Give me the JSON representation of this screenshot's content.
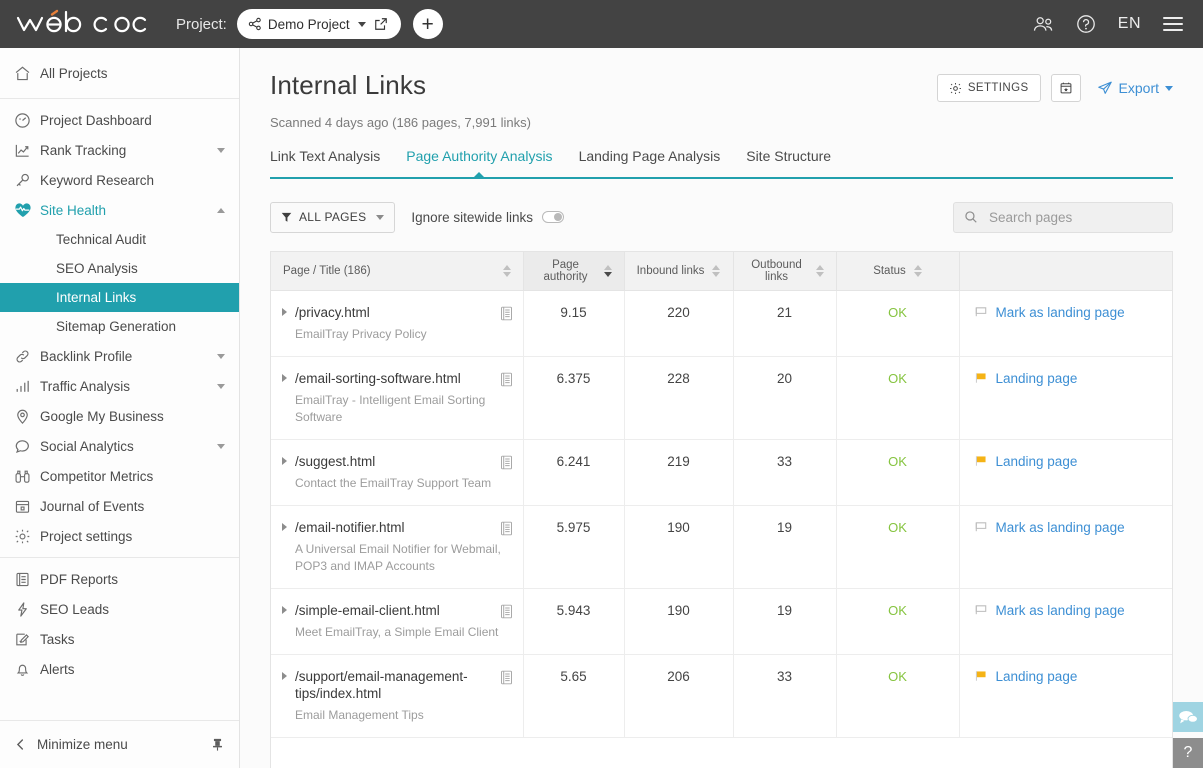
{
  "topbar": {
    "logo_text": "web ceo",
    "project_label": "Project:",
    "project_name": "Demo Project",
    "add_title": "+",
    "language": "EN"
  },
  "sidebar": {
    "home": {
      "label": "All Projects",
      "icon": "home-icon"
    },
    "items": [
      {
        "label": "Project Dashboard",
        "icon": "dashboard-icon",
        "expandable": false
      },
      {
        "label": "Rank Tracking",
        "icon": "chart-line-icon",
        "expandable": true
      },
      {
        "label": "Keyword Research",
        "icon": "key-icon",
        "expandable": false
      },
      {
        "label": "Site Health",
        "icon": "heartbeat-icon",
        "expandable": true,
        "active": true,
        "expanded": true
      },
      {
        "label": "Backlink Profile",
        "icon": "link-icon",
        "expandable": true
      },
      {
        "label": "Traffic Analysis",
        "icon": "bar-chart-icon",
        "expandable": true
      },
      {
        "label": "Google My Business",
        "icon": "map-pin-icon",
        "expandable": false
      },
      {
        "label": "Social Analytics",
        "icon": "speech-bubble-icon",
        "expandable": true
      },
      {
        "label": "Competitor Metrics",
        "icon": "binoculars-icon",
        "expandable": false
      },
      {
        "label": "Journal of Events",
        "icon": "calendar-icon",
        "expandable": false
      },
      {
        "label": "Project settings",
        "icon": "gear-icon",
        "expandable": false
      }
    ],
    "site_health_children": [
      {
        "label": "Technical Audit"
      },
      {
        "label": "SEO Analysis"
      },
      {
        "label": "Internal Links",
        "selected": true
      },
      {
        "label": "Sitemap Generation"
      }
    ],
    "secondary_items": [
      {
        "label": "PDF Reports",
        "icon": "document-list-icon"
      },
      {
        "label": "SEO Leads",
        "icon": "bolt-icon"
      },
      {
        "label": "Tasks",
        "icon": "task-edit-icon"
      },
      {
        "label": "Alerts",
        "icon": "bell-icon"
      }
    ],
    "footer": {
      "label": "Minimize menu",
      "icon": "chevron-left-icon",
      "pin_icon": "pin-icon"
    }
  },
  "page": {
    "title": "Internal Links",
    "scanned": "Scanned 4 days ago  (186 pages, 7,991 links)",
    "settings_label": "SETTINGS",
    "export_label": "Export"
  },
  "tabs": [
    {
      "label": "Link Text Analysis",
      "active": false
    },
    {
      "label": "Page Authority Analysis",
      "active": true
    },
    {
      "label": "Landing Page Analysis",
      "active": false
    },
    {
      "label": "Site Structure",
      "active": false
    }
  ],
  "toolbar": {
    "filter_label": "ALL PAGES",
    "ignore_label": "Ignore sitewide links",
    "ignore_enabled": false,
    "search_placeholder": "Search pages",
    "search_value": ""
  },
  "table": {
    "columns": [
      {
        "label": "Page / Title (186)",
        "sorted": false
      },
      {
        "label": "Page authority",
        "sorted": true,
        "direction": "desc"
      },
      {
        "label": "Inbound links",
        "sorted": false
      },
      {
        "label": "Outbound links",
        "sorted": false
      },
      {
        "label": "Status",
        "sorted": false
      },
      {
        "label": "",
        "sorted": false
      }
    ],
    "rows": [
      {
        "url": "/privacy.html",
        "title": "EmailTray Privacy Policy",
        "page_authority": "9.15",
        "inbound": "220",
        "outbound": "21",
        "status": "OK",
        "action": "Mark as landing page",
        "is_landing": false
      },
      {
        "url": "/email-sorting-software.html",
        "title": "EmailTray - Intelligent Email Sorting Software",
        "page_authority": "6.375",
        "inbound": "228",
        "outbound": "20",
        "status": "OK",
        "action": "Landing page",
        "is_landing": true
      },
      {
        "url": "/suggest.html",
        "title": "Contact the EmailTray Support Team",
        "page_authority": "6.241",
        "inbound": "219",
        "outbound": "33",
        "status": "OK",
        "action": "Landing page",
        "is_landing": true
      },
      {
        "url": "/email-notifier.html",
        "title": "A Universal Email Notifier for Webmail, POP3 and IMAP Accounts",
        "page_authority": "5.975",
        "inbound": "190",
        "outbound": "19",
        "status": "OK",
        "action": "Mark as landing page",
        "is_landing": false
      },
      {
        "url": "/simple-email-client.html",
        "title": "Meet EmailTray, a Simple Email Client",
        "page_authority": "5.943",
        "inbound": "190",
        "outbound": "19",
        "status": "OK",
        "action": "Mark as landing page",
        "is_landing": false
      },
      {
        "url": "/support/email-management-tips/index.html",
        "title": "Email Management Tips",
        "page_authority": "5.65",
        "inbound": "206",
        "outbound": "33",
        "status": "OK",
        "action": "Landing page",
        "is_landing": true
      }
    ]
  },
  "widgets": {
    "chat_icon": "chat-bubbles-icon",
    "help_label": "?"
  },
  "colors": {
    "accent_teal": "#21a0ad",
    "link_blue": "#3d8fd4",
    "status_green": "#86c440",
    "flag_orange": "#f5b316",
    "topbar_dark": "#434343"
  }
}
